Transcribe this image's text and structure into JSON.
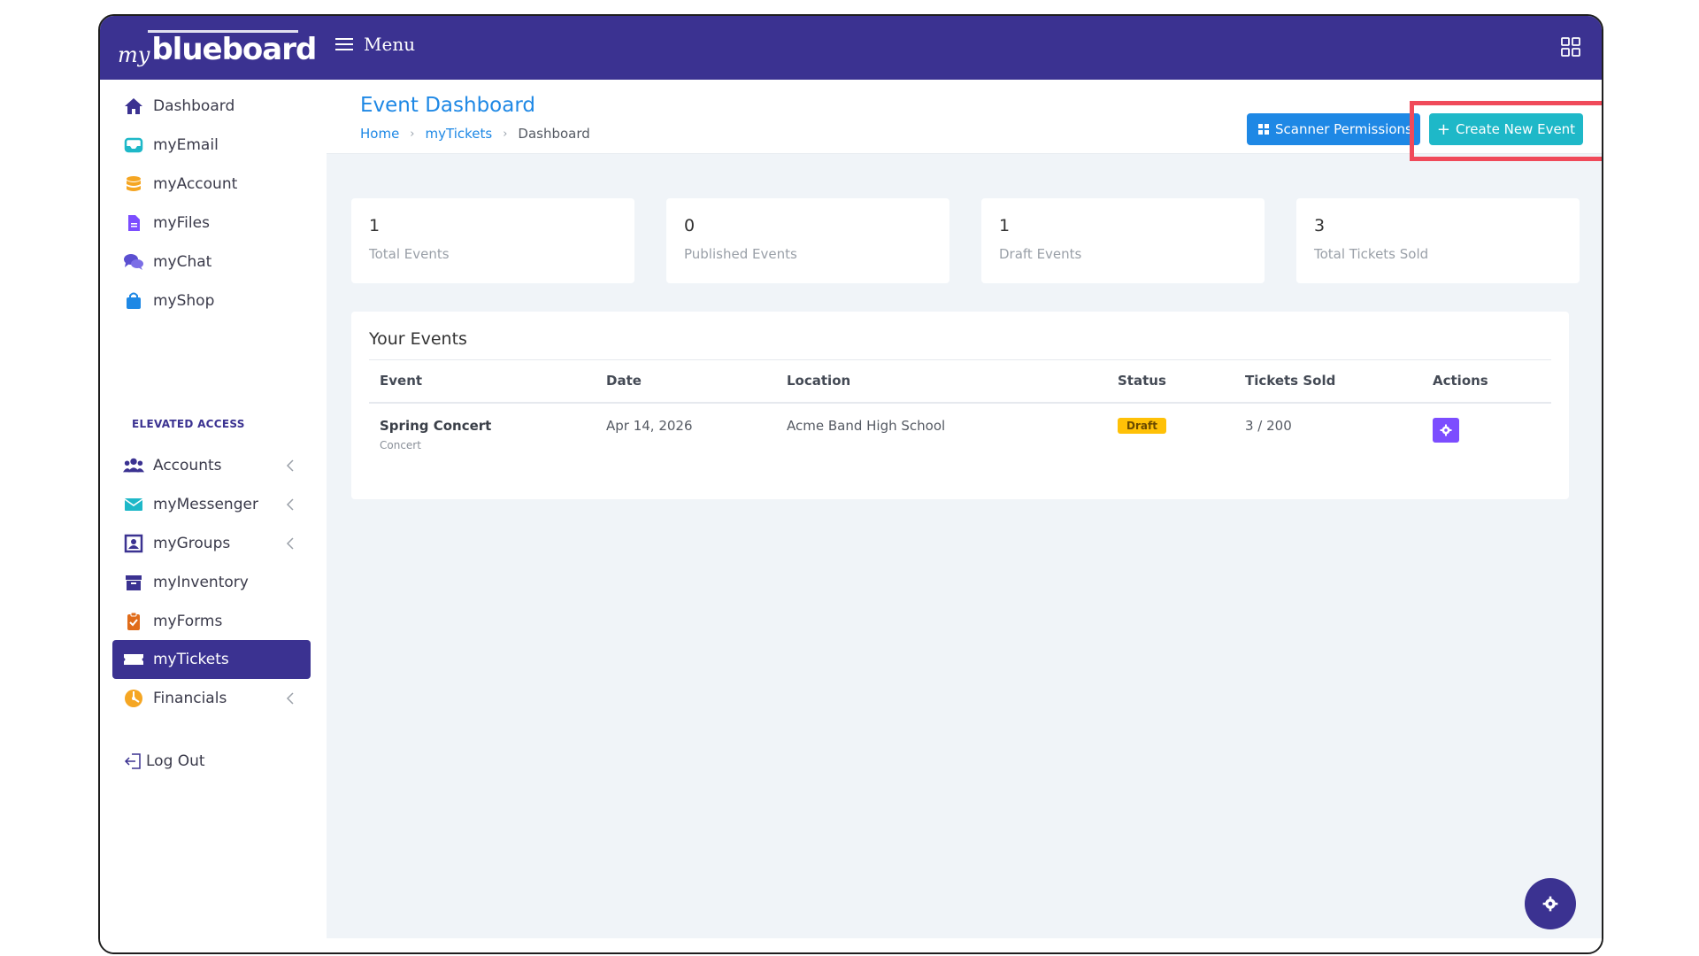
{
  "brand": {
    "prefix": "my",
    "name": "blueboard"
  },
  "topbar": {
    "menu_label": "Menu",
    "apps_icon": "grid-icon"
  },
  "sidebar": {
    "items": [
      {
        "label": "Dashboard",
        "icon": "home-icon",
        "color": "#3b3291"
      },
      {
        "label": "myEmail",
        "icon": "inbox-icon",
        "color": "#1eb8c8"
      },
      {
        "label": "myAccount",
        "icon": "database-icon",
        "color": "#f5a623"
      },
      {
        "label": "myFiles",
        "icon": "file-icon",
        "color": "#7c4dff"
      },
      {
        "label": "myChat",
        "icon": "chat-icon",
        "color": "#5b4fd1"
      },
      {
        "label": "myShop",
        "icon": "shopping-bag-icon",
        "color": "#1e88e5"
      }
    ],
    "section_label": "ELEVATED ACCESS",
    "elevated_items": [
      {
        "label": "Accounts",
        "icon": "users-icon",
        "color": "#3b3291"
      },
      {
        "label": "myMessenger",
        "icon": "envelope-icon",
        "color": "#1eb8c8"
      },
      {
        "label": "myGroups",
        "icon": "groups-icon",
        "color": "#3b3291"
      },
      {
        "label": "myInventory",
        "icon": "archive-icon",
        "color": "#3b3291"
      },
      {
        "label": "myForms",
        "icon": "clipboard-icon",
        "color": "#e06c1a"
      },
      {
        "label": "myTickets",
        "icon": "ticket-icon",
        "color": "#ffffff"
      },
      {
        "label": "Financials",
        "icon": "pie-chart-icon",
        "color": "#f5a623"
      }
    ],
    "logout_label": "Log Out",
    "active_item": "myTickets"
  },
  "header": {
    "title": "Event Dashboard",
    "breadcrumb": [
      "Home",
      "myTickets",
      "Dashboard"
    ],
    "scanner_button": "Scanner Permissions",
    "create_button": "Create New Event"
  },
  "stats": [
    {
      "value": "1",
      "label": "Total Events"
    },
    {
      "value": "0",
      "label": "Published Events"
    },
    {
      "value": "1",
      "label": "Draft Events"
    },
    {
      "value": "3",
      "label": "Total Tickets Sold"
    }
  ],
  "events": {
    "title": "Your Events",
    "columns": [
      "Event",
      "Date",
      "Location",
      "Status",
      "Tickets Sold",
      "Actions"
    ],
    "rows": [
      {
        "name": "Spring Concert",
        "type": "Concert",
        "date": "Apr 14, 2026",
        "location": "Acme Band High School",
        "status": "Draft",
        "tickets": "3 / 200"
      }
    ]
  },
  "colors": {
    "primary": "#3b3291",
    "blue": "#1e88e5",
    "teal": "#1eb8c8",
    "highlight": "#f04a5a",
    "draft": "#ffc107"
  }
}
